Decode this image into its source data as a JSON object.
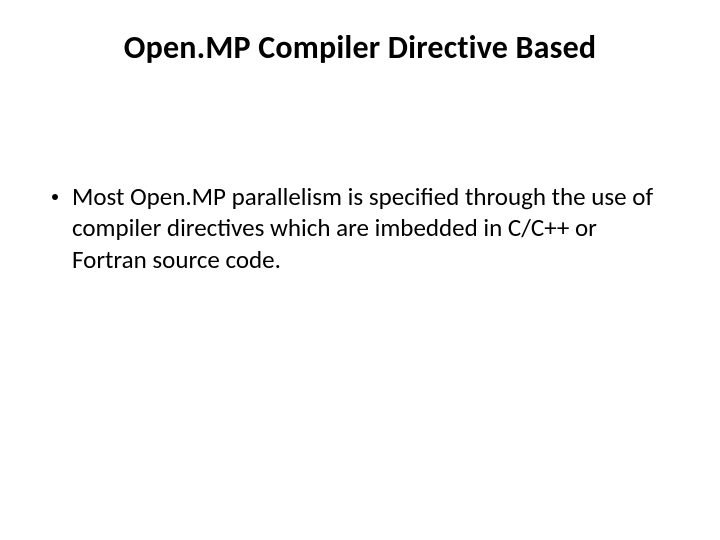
{
  "slide": {
    "title": "Open.MP Compiler Directive Based",
    "bullets": [
      "Most Open.MP parallelism is specified through the use of compiler directives which are imbedded in C/C++ or Fortran source code."
    ]
  }
}
